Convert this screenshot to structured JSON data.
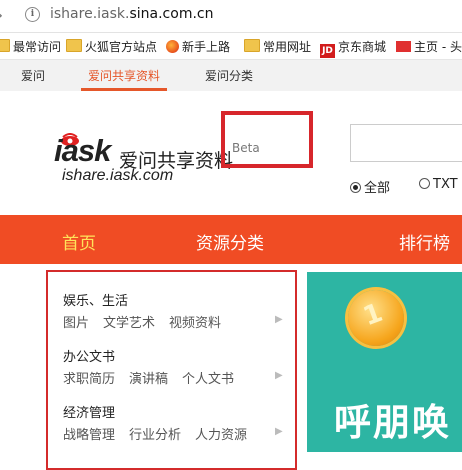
{
  "browser": {
    "url_prefix": "ishare.iask.",
    "url_domain": "sina.com.cn"
  },
  "bookmarks": [
    {
      "label": "最常访问",
      "icon": "folder-icon"
    },
    {
      "label": "火狐官方站点",
      "icon": "folder-icon"
    },
    {
      "label": "新手上路",
      "icon": "firefox-icon"
    },
    {
      "label": "常用网址",
      "icon": "folder-icon"
    },
    {
      "label": "京东商城",
      "icon": "jd-icon"
    },
    {
      "label": "主页 - 头",
      "icon": "site-icon"
    }
  ],
  "subnav": {
    "items": [
      "爱问",
      "爱问共享资料",
      "爱问分类"
    ],
    "active": "爱问共享资料",
    "accent": "#e5572a"
  },
  "logo": {
    "word": "iask",
    "cn": "爱问共享资料",
    "domain": "ishare.iask.com"
  },
  "beta": "Beta",
  "search": {
    "options": [
      "全部",
      "TXT"
    ],
    "selected": "全部"
  },
  "mainnav": {
    "items": [
      "首页",
      "资源分类",
      "排行榜"
    ],
    "active": "首页",
    "bg": "#f04c24"
  },
  "categories": [
    {
      "title": "娱乐、生活",
      "subs": [
        "图片",
        "文学艺术",
        "视频资料"
      ]
    },
    {
      "title": "办公文书",
      "subs": [
        "求职简历",
        "演讲稿",
        "个人文书"
      ]
    },
    {
      "title": "经济管理",
      "subs": [
        "战略管理",
        "行业分析",
        "人力资源"
      ]
    }
  ],
  "banner": {
    "coin_text": "1",
    "text": "呼朋唤"
  }
}
